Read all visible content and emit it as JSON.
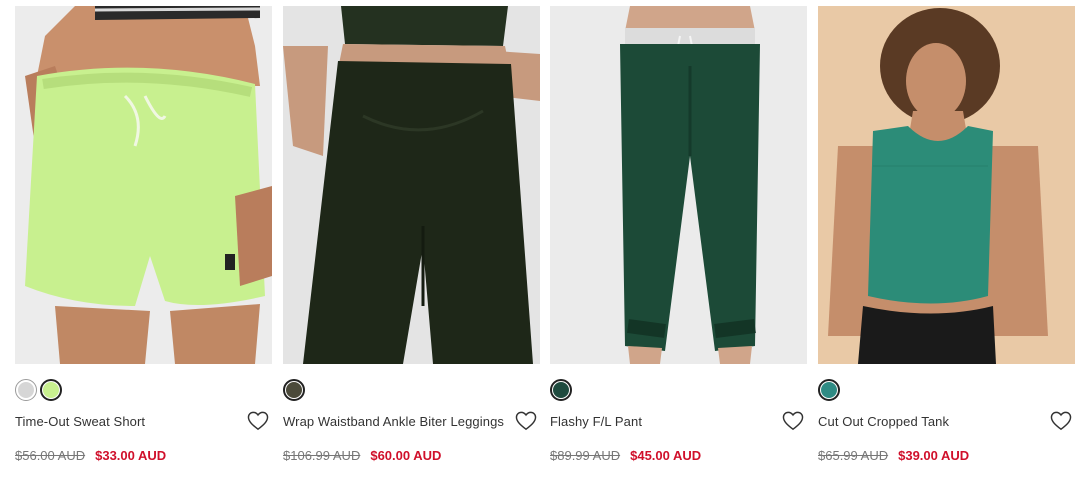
{
  "products": [
    {
      "name": "Time-Out Sweat Short",
      "image": "green sweat shorts on model",
      "swatches": [
        "#d6d6d6",
        "#c8f08f"
      ],
      "selected_swatch": 1,
      "was_price": "$56.00 AUD",
      "now_price": "$33.00 AUD"
    },
    {
      "name": "Wrap Waistband Ankle Biter Leggings",
      "image": "dark khaki leggings on model",
      "swatches": [
        "#4b4a3a"
      ],
      "selected_swatch": 0,
      "was_price": "$106.99 AUD",
      "now_price": "$60.00 AUD"
    },
    {
      "name": "Flashy F/L Pant",
      "image": "dark green track pants on model",
      "swatches": [
        "#1f4b3f"
      ],
      "selected_swatch": 0,
      "was_price": "$89.99 AUD",
      "now_price": "$45.00 AUD"
    },
    {
      "name": "Cut Out Cropped Tank",
      "image": "teal cropped tank on model",
      "swatches": [
        "#2f8b84"
      ],
      "selected_swatch": 0,
      "was_price": "$65.99 AUD",
      "now_price": "$39.00 AUD"
    }
  ],
  "icons": {
    "wishlist": "heart-outline-icon"
  },
  "colors": {
    "sale": "#d0102b",
    "was": "#777777"
  }
}
